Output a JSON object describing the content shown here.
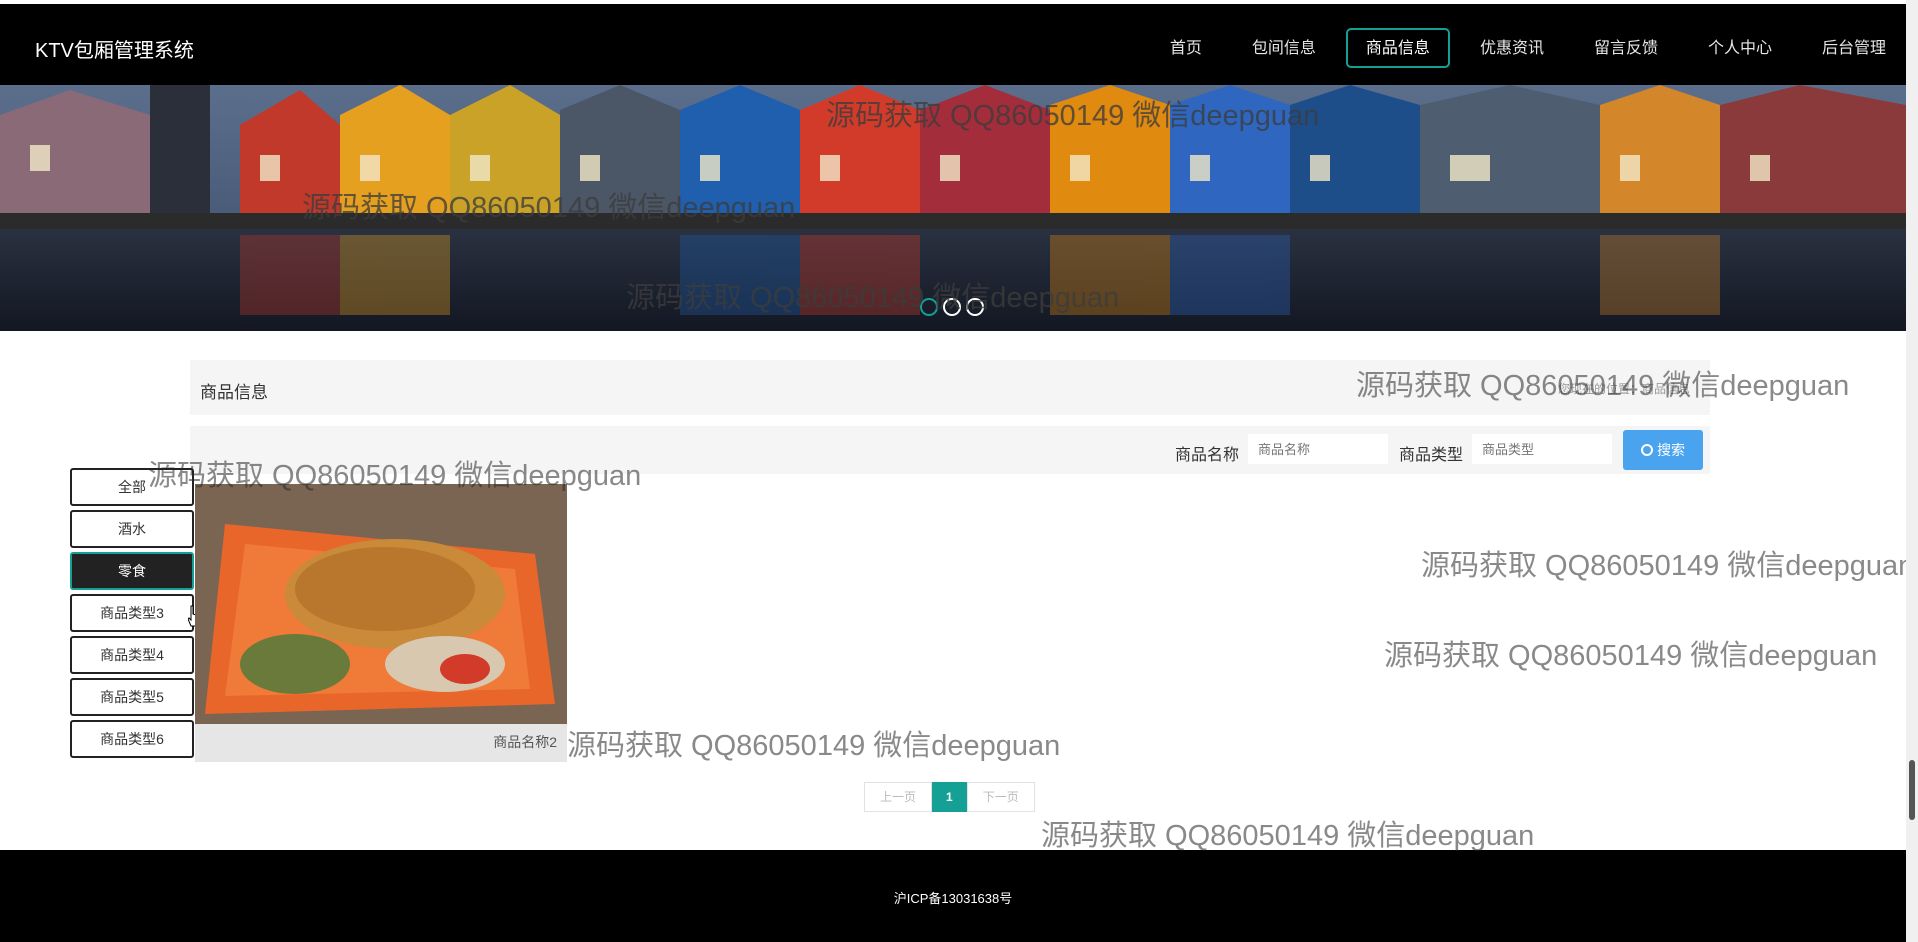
{
  "nav": {
    "brand": "KTV包厢管理系统",
    "items": [
      {
        "label": "首页"
      },
      {
        "label": "包间信息"
      },
      {
        "label": "商品信息",
        "active": true
      },
      {
        "label": "优惠资讯"
      },
      {
        "label": "留言反馈"
      },
      {
        "label": "个人中心"
      },
      {
        "label": "后台管理"
      }
    ]
  },
  "banner": {
    "slides": 3,
    "active_slide": 1
  },
  "section": {
    "title": "商品信息",
    "breadcrumb": "您现在的位置：商品信息"
  },
  "search": {
    "name_label": "商品名称",
    "name_placeholder": "商品名称",
    "type_label": "商品类型",
    "type_placeholder": "商品类型",
    "button_label": "搜索"
  },
  "categories": [
    {
      "label": "全部"
    },
    {
      "label": "酒水"
    },
    {
      "label": "零食",
      "active": true
    },
    {
      "label": "商品类型3"
    },
    {
      "label": "商品类型4"
    },
    {
      "label": "商品类型5"
    },
    {
      "label": "商品类型6"
    }
  ],
  "products": [
    {
      "name": "商品名称2"
    }
  ],
  "pager": {
    "prev": "上一页",
    "current": "1",
    "next": "下一页"
  },
  "footer": {
    "icp": "沪ICP备13031638号"
  },
  "watermark": "源码获取 QQ86050149 微信deepguan",
  "colors": {
    "accent": "#15a095",
    "search_button": "#4aa3ef",
    "nav_bg": "#000000"
  }
}
